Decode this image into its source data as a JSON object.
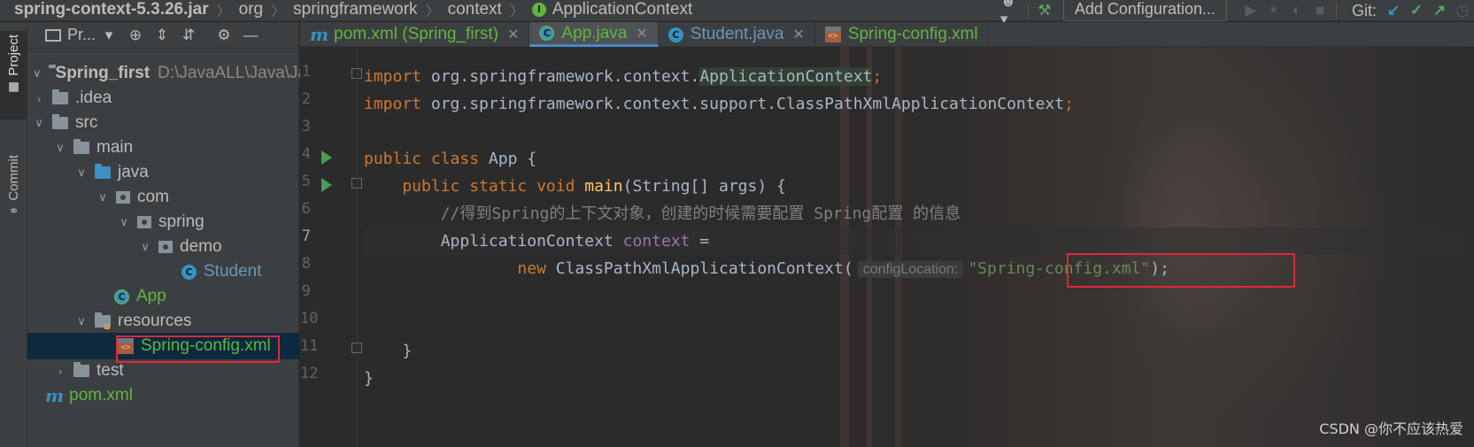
{
  "navbar": {
    "breadcrumbs": [
      "spring-context-5.3.26.jar",
      "org",
      "springframework",
      "context",
      "ApplicationContext"
    ],
    "interface_icon_letter": "I",
    "add_config_label": "Add Configuration...",
    "git_label": "Git:",
    "icons": [
      "user-icon",
      "hammer-icon",
      "run-icon",
      "debug-icon",
      "coverage-icon",
      "stop-icon",
      "vcs-update-icon",
      "vcs-commit-icon",
      "vcs-push-icon",
      "history-icon"
    ]
  },
  "stripe": {
    "project_label": "Project",
    "commit_label": "Commit"
  },
  "project_panel": {
    "toolbar_label": "Pr...",
    "tree": [
      {
        "label": "Spring_first",
        "path": "D:\\JavaALL\\Java\\Jav",
        "type": "module",
        "expanded": true
      },
      {
        "label": ".idea",
        "type": "folder",
        "expanded": false
      },
      {
        "label": "src",
        "type": "folder",
        "expanded": true
      },
      {
        "label": "main",
        "type": "folder",
        "expanded": true
      },
      {
        "label": "java",
        "type": "source-folder",
        "expanded": true
      },
      {
        "label": "com",
        "type": "package",
        "expanded": true
      },
      {
        "label": "spring",
        "type": "package",
        "expanded": true
      },
      {
        "label": "demo",
        "type": "package",
        "expanded": true
      },
      {
        "label": "Student",
        "type": "class"
      },
      {
        "label": "App",
        "type": "class-runnable"
      },
      {
        "label": "resources",
        "type": "resources-folder",
        "expanded": true
      },
      {
        "label": "Spring-config.xml",
        "type": "xml",
        "selected": true
      },
      {
        "label": "test",
        "type": "folder",
        "expanded": false
      },
      {
        "label": "pom.xml",
        "type": "maven"
      }
    ]
  },
  "tabs": [
    {
      "label": "pom.xml (Spring_first)",
      "icon": "maven-icon",
      "active": false
    },
    {
      "label": "App.java",
      "icon": "class-icon",
      "active": true
    },
    {
      "label": "Student.java",
      "icon": "class-icon",
      "active": false
    },
    {
      "label": "Spring-config.xml",
      "icon": "xml-icon",
      "active": false
    }
  ],
  "code": {
    "line_numbers": [
      "1",
      "2",
      "3",
      "4",
      "5",
      "6",
      "7",
      "8",
      "9",
      "10",
      "11",
      "12"
    ],
    "current_line": "7",
    "l1_kw": "import",
    "l1_pkg": " org.springframework.context.",
    "l1_cls": "ApplicationContext",
    "l1_semi": ";",
    "l2_kw": "import",
    "l2_pkg": " org.springframework.context.support.ClassPathXmlApplicationContext",
    "l2_semi": ";",
    "l4_kw": "public class ",
    "l4_name": "App {",
    "l5_kw": "    public static void ",
    "l5_fn": "main",
    "l5_rest": "(String[] args) {",
    "l6_cmt": "        //得到Spring的上下文对象，创建的时候需要配置 Spring配置 的信息",
    "l7_type": "        ApplicationContext ",
    "l7_var": "context",
    "l7_eq": " =",
    "l8_kw": "                new ",
    "l8_cls": "ClassPathXmlApplicationContext(",
    "l8_hint": "configLocation:",
    "l8_str": "\"Spring-config.xml\"",
    "l8_end": ");",
    "l10": "    }",
    "l11": "}"
  },
  "watermark": "CSDN @你不应该热爱"
}
